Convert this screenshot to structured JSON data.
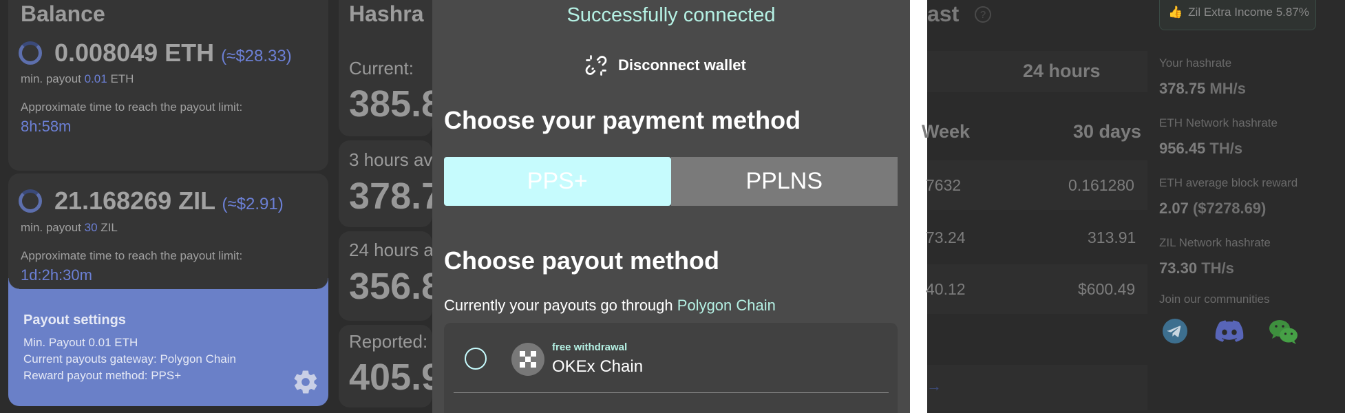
{
  "balance": {
    "title": "Balance",
    "eth": {
      "amount": "0.008049 ETH",
      "usd": "(≈$28.33)",
      "min_prefix": "min. payout",
      "min_value": "0.01",
      "min_unit": "ETH",
      "time_label": "Approximate time to reach the payout limit:",
      "time_value": "8h:58m"
    },
    "zil": {
      "amount": "21.168269 ZIL",
      "usd": "(≈$2.91)",
      "min_prefix": "min. payout",
      "min_value": "30",
      "min_unit": "ZIL",
      "time_label": "Approximate time to reach the payout limit:",
      "time_value": "1d:2h:30m"
    }
  },
  "payout_settings": {
    "title": "Payout settings",
    "min_payout": "Min. Payout 0.01 ETH",
    "gateway": "Current payouts gateway: Polygon Chain",
    "method": "Reward payout method: PPS+"
  },
  "hashrate": {
    "title": "Hashra",
    "current_label": "Current:",
    "current_value": "385.8",
    "h3_label": "3 hours av",
    "h3_value": "378.7",
    "h24_label": "24 hours a",
    "h24_value": "356.8",
    "reported_label": "Reported:",
    "reported_value": "405.9"
  },
  "modal": {
    "success": "Successfully connected",
    "disconnect": "Disconnect wallet",
    "payment_title": "Choose your payment method",
    "payment_options": [
      "PPS+",
      "PPLNS"
    ],
    "payout_title": "Choose payout method",
    "current_prefix": "Currently your payouts go through",
    "current_chain": "Polygon Chain",
    "option": {
      "badge": "free withdrawal",
      "name": "OKEx Chain"
    }
  },
  "forecast": {
    "title": "ast",
    "help": "?",
    "h24": "24 hours",
    "week": "Week",
    "days30": "30 days",
    "rows": [
      {
        "left": "7632",
        "right": "0.161280"
      },
      {
        "left": "73.24",
        "right": "313.91"
      },
      {
        "left": "40.12",
        "right": "$600.49"
      }
    ],
    "footer_arrow": "→"
  },
  "stats": {
    "badge": "Zil Extra Income 5.87%",
    "your_hashrate_label": "Your hashrate",
    "your_hashrate_value": "378.75",
    "your_hashrate_unit": "MH/s",
    "eth_net_label": "ETH Network hashrate",
    "eth_net_value": "956.45",
    "eth_net_unit": "TH/s",
    "eth_block_label": "ETH average block reward",
    "eth_block_value": "2.07",
    "eth_block_usd": "($7278.69)",
    "zil_net_label": "ZIL Network hashrate",
    "zil_net_value": "73.30",
    "zil_net_unit": "TH/s",
    "communities_label": "Join our communities"
  },
  "colors": {
    "accent_blue": "#6c80d6",
    "mint": "#b5f1e4",
    "payout_box": "#6a80c8",
    "active_segment": "#c6fbfd"
  }
}
